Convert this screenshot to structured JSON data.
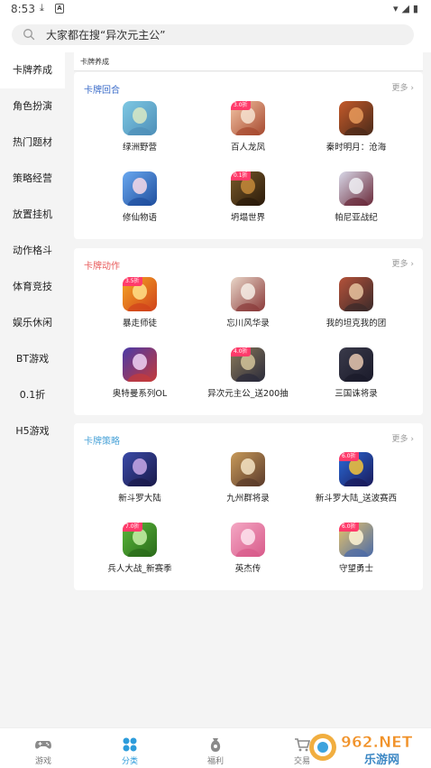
{
  "status_bar": {
    "time": "8:53",
    "download_glyph": "⤓",
    "app_glyph": "A",
    "right_glyphs": "▾◢▮"
  },
  "search": {
    "placeholder": "大家都在搜“异次元主公”"
  },
  "sidebar": {
    "items": [
      {
        "label": "卡牌养成",
        "active": true
      },
      {
        "label": "角色扮演"
      },
      {
        "label": "热门题材"
      },
      {
        "label": "策略经营"
      },
      {
        "label": "放置挂机"
      },
      {
        "label": "动作格斗"
      },
      {
        "label": "体育竞技"
      },
      {
        "label": "娱乐休闲"
      },
      {
        "label": "BT游戏"
      },
      {
        "label": "0.1折"
      },
      {
        "label": "H5游戏"
      }
    ]
  },
  "main": {
    "sub_title": "卡牌养成",
    "sections": [
      {
        "title": "卡牌回合",
        "title_color": "#3b6cc9",
        "more": "更多 ›",
        "games": [
          {
            "name": "绿洲野营",
            "badge": "",
            "icon": "oasis-camp-icon",
            "colors": [
              "#7ec8e3",
              "#4e8fb8",
              "#d9e9c4"
            ]
          },
          {
            "name": "百人龙凤",
            "badge": "3.0折",
            "icon": "dragon-phoenix-icon",
            "colors": [
              "#f3c4a4",
              "#a6492f",
              "#f6e2d0"
            ]
          },
          {
            "name": "秦时明月：沧海",
            "badge": "",
            "icon": "qin-moon-icon",
            "colors": [
              "#c45a2a",
              "#4a2a1a",
              "#e89a5a"
            ]
          },
          {
            "name": "修仙物语",
            "badge": "",
            "icon": "cultivation-story-icon",
            "colors": [
              "#6aa8f0",
              "#1f4f9e",
              "#f7d9e8"
            ]
          },
          {
            "name": "坍塌世界",
            "badge": "0.1折",
            "icon": "collapse-world-icon",
            "colors": [
              "#7a5a2a",
              "#2a1a0a",
              "#c48a3a"
            ]
          },
          {
            "name": "帕尼亚战纪",
            "badge": "",
            "icon": "pania-war-icon",
            "colors": [
              "#d8d8e8",
              "#6a2a3a",
              "#f0f0f4"
            ]
          }
        ]
      },
      {
        "title": "卡牌动作",
        "title_color": "#e85a5a",
        "more": "更多 ›",
        "games": [
          {
            "name": "暴走师徒",
            "badge": "3.5折",
            "icon": "rampage-master-icon",
            "colors": [
              "#f5a623",
              "#d0421b",
              "#ffe08a"
            ]
          },
          {
            "name": "忘川风华录",
            "badge": "",
            "icon": "wangchuan-icon",
            "colors": [
              "#e9d6c8",
              "#8a3a3a",
              "#f6ede6"
            ]
          },
          {
            "name": "我的坦克我的团",
            "badge": "",
            "icon": "my-tank-icon",
            "colors": [
              "#b5523a",
              "#3a2a2a",
              "#e8c4a0"
            ]
          },
          {
            "name": "奥特曼系列OL",
            "badge": "",
            "icon": "ultraman-icon",
            "colors": [
              "#4a3aa8",
              "#c43a3a",
              "#f0d4f4"
            ]
          },
          {
            "name": "异次元主公_送200抽",
            "badge": "4.0折",
            "icon": "otherworld-lord-icon",
            "colors": [
              "#8a7a5a",
              "#2a2a3a",
              "#d4c49a"
            ]
          },
          {
            "name": "三国诛将录",
            "badge": "",
            "icon": "three-kingdoms-icon",
            "colors": [
              "#3a3a4a",
              "#1a1a2a",
              "#e8c8b0"
            ]
          }
        ]
      },
      {
        "title": "卡牌策略",
        "title_color": "#4aa3d8",
        "more": "更多 ›",
        "games": [
          {
            "name": "新斗罗大陆",
            "badge": "",
            "icon": "new-douluo-icon",
            "colors": [
              "#3a4aa8",
              "#1a1a4a",
              "#c8a8e8"
            ]
          },
          {
            "name": "九州群将录",
            "badge": "",
            "icon": "jiuzhou-icon",
            "colors": [
              "#c89a5a",
              "#5a3a2a",
              "#f4e4c4"
            ]
          },
          {
            "name": "新斗罗大陆_送波赛西",
            "badge": "6.0折",
            "icon": "douluo-gift-icon",
            "colors": [
              "#2a6ad8",
              "#1a1a5a",
              "#f4c43a"
            ]
          },
          {
            "name": "兵人大战_新赛季",
            "badge": "7.0折",
            "icon": "soldier-war-icon",
            "colors": [
              "#5ab83a",
              "#2a6a1a",
              "#c8f0a8"
            ]
          },
          {
            "name": "英杰传",
            "badge": "",
            "icon": "heroes-legend-icon",
            "colors": [
              "#f4a8c4",
              "#d85a8a",
              "#fde4ee"
            ]
          },
          {
            "name": "守望勇士",
            "badge": "6.0折",
            "icon": "watch-warrior-icon",
            "colors": [
              "#e8c46a",
              "#4a6aa8",
              "#fff4d4"
            ]
          }
        ]
      }
    ]
  },
  "bottom_nav": {
    "tabs": [
      {
        "label": "游戏",
        "icon": "gamepad-icon",
        "active": false
      },
      {
        "label": "分类",
        "icon": "category-icon",
        "active": true
      },
      {
        "label": "福利",
        "icon": "gift-bag-icon",
        "active": false
      },
      {
        "label": "交易",
        "icon": "cart-icon",
        "active": false
      }
    ]
  },
  "watermark": {
    "brand": "962.NET",
    "sub": "乐游网"
  },
  "colors": {
    "accent": "#2d9cdb",
    "badge": "#ff3b6b",
    "sidebar_bg": "#f4f4f4",
    "card_bg": "#ffffff"
  }
}
